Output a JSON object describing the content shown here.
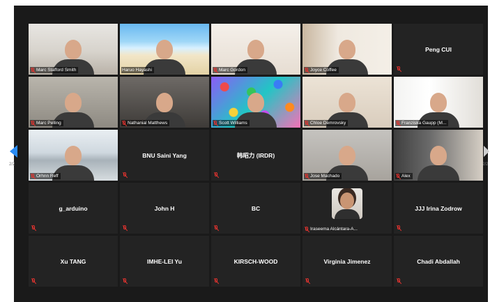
{
  "meeting": {
    "page_left": "2/2",
    "page_right": "2/2",
    "participants": [
      {
        "name": "Marc Stafford Smith",
        "video": true,
        "scene": "office",
        "muted": true
      },
      {
        "name": "Haruo Hayashi",
        "video": true,
        "scene": "beach",
        "muted": false
      },
      {
        "name": "Marc Gordon",
        "video": true,
        "scene": "wall",
        "muted": true
      },
      {
        "name": "Joyce Coffee",
        "video": true,
        "scene": "bookcase",
        "muted": true
      },
      {
        "name": "Peng CUI",
        "video": false,
        "muted": true
      },
      {
        "name": "Marc Pelling",
        "video": true,
        "scene": "room",
        "muted": true
      },
      {
        "name": "Nathanial Matthews",
        "video": true,
        "scene": "dark",
        "muted": true
      },
      {
        "name": "Scott Williams",
        "video": true,
        "scene": "colorful",
        "muted": true
      },
      {
        "name": "Chloe Demrovsky",
        "video": true,
        "scene": "cream",
        "muted": true
      },
      {
        "name": "Franziska Gaupp (M...",
        "video": true,
        "scene": "window",
        "muted": true
      },
      {
        "name": "Orhnn Reff",
        "video": true,
        "scene": "lake",
        "muted": true
      },
      {
        "name": "BNU Saini Yang",
        "video": false,
        "muted": true
      },
      {
        "name": "韩昭力 (IRDR)",
        "video": false,
        "muted": true
      },
      {
        "name": "Jose Machado",
        "video": true,
        "scene": "grey",
        "muted": true,
        "active": true
      },
      {
        "name": "Alex",
        "video": true,
        "scene": "home",
        "muted": true
      },
      {
        "name": "g_arduino",
        "video": false,
        "muted": true
      },
      {
        "name": "John H",
        "video": false,
        "muted": true
      },
      {
        "name": "BC",
        "video": false,
        "muted": true
      },
      {
        "name": "Iraseema Alcántara-A...",
        "video": false,
        "photo": true,
        "muted": true
      },
      {
        "name": "JJJ Irina Zodrow",
        "video": false,
        "muted": true
      },
      {
        "name": "Xu TANG",
        "video": false,
        "muted": true
      },
      {
        "name": "IMHE-LEI Yu",
        "video": false,
        "muted": true
      },
      {
        "name": "KIRSCH-WOOD",
        "video": false,
        "muted": true
      },
      {
        "name": "Virginia Jimenez",
        "video": false,
        "muted": true
      },
      {
        "name": "Chadi Abdallah",
        "video": false,
        "muted": true
      }
    ]
  },
  "colors": {
    "background": "#1a1a1a",
    "tile": "#232323",
    "muted_icon": "#e2332f",
    "active_speaker": "#d4e400",
    "nav_arrow": "#2a8cf6"
  }
}
